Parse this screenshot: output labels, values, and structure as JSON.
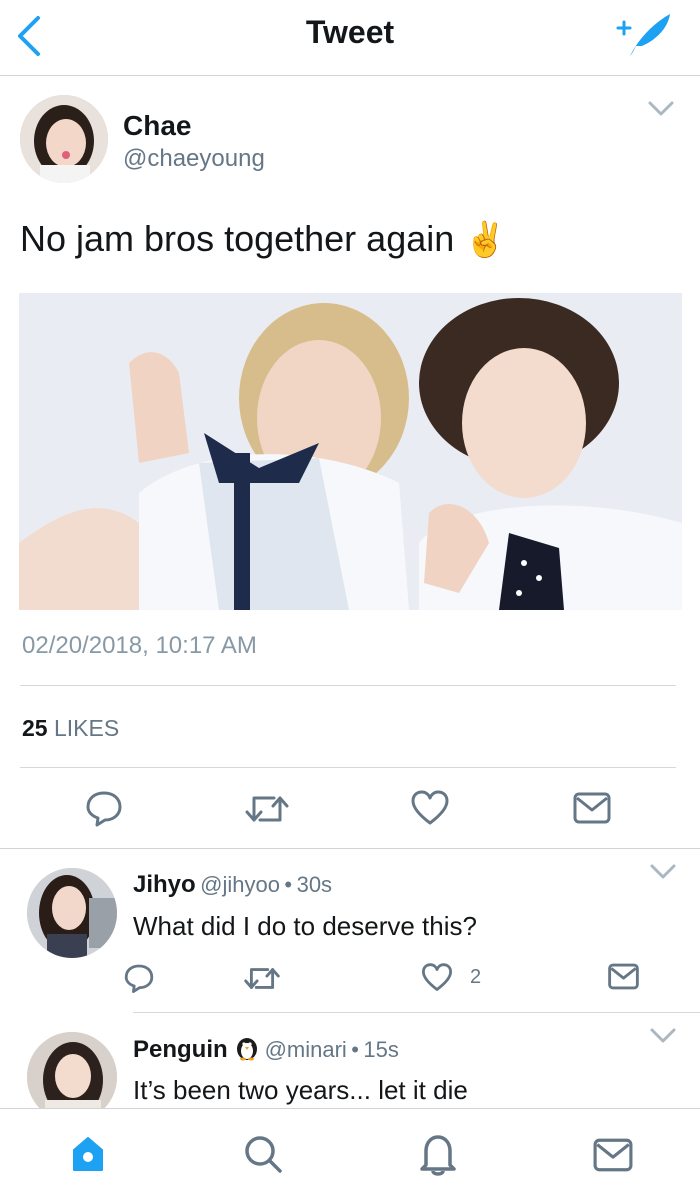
{
  "header": {
    "title": "Tweet",
    "back_icon": "chevron-left-icon",
    "compose_icon": "compose-quill-icon",
    "accent": "#1da1f2"
  },
  "tweet": {
    "author_name": "Chae",
    "author_handle": "@chaeyoung",
    "text": "No jam bros together again",
    "emoji": "✌",
    "timestamp": "02/20/2018, 10:17 AM",
    "likes_count": "25",
    "likes_label": "LIKES"
  },
  "replies": [
    {
      "name": "Jihyo",
      "handle": "@jihyoo",
      "sep": "•",
      "time": "30s",
      "text": "What did I do to deserve this?",
      "like_count": "2"
    },
    {
      "name": "Penguin",
      "handle": "@minari",
      "sep": "•",
      "time": "15s",
      "text": "It’s been two years... let it die"
    }
  ],
  "tabbar": {
    "items": [
      "home-icon",
      "search-icon",
      "notifications-icon",
      "messages-icon"
    ],
    "active": "home"
  }
}
